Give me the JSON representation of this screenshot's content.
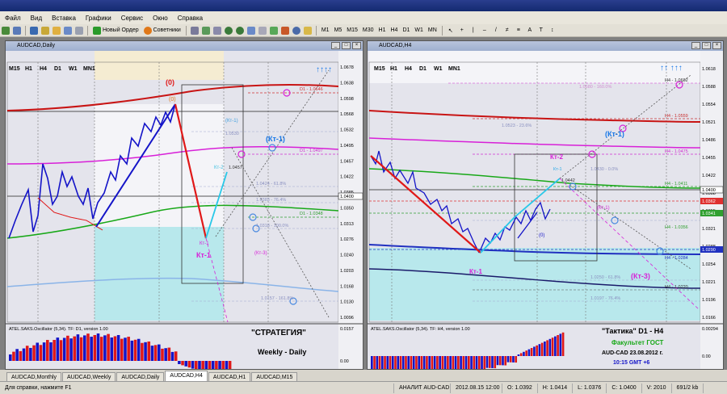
{
  "menu": [
    "Файл",
    "Вид",
    "Вставка",
    "Графики",
    "Сервис",
    "Окно",
    "Справка"
  ],
  "toolbar": {
    "new_order_label": "Новый Ордер",
    "advisors_label": "Советники",
    "timeframes": [
      "M1",
      "M5",
      "M15",
      "M30",
      "H1",
      "H4",
      "D1",
      "W1",
      "MN"
    ]
  },
  "left_chart": {
    "title": "AUDCAD,Daily",
    "tf_buttons": [
      "M15",
      "H1",
      "H4",
      "D1",
      "W1",
      "MN1"
    ],
    "price_axis": [
      "1.0678",
      "1.0638",
      "1.0598",
      "1.0568",
      "1.0532",
      "1.0495",
      "1.0457",
      "1.0422",
      "1.0385",
      "1.0350",
      "1.0313",
      "1.0276",
      "1.0240",
      "1.0203",
      "1.0168",
      "1.0130",
      "1.0096"
    ],
    "price_tag_current": "1.0400",
    "level_labels": {
      "d1_top": "D1 - 1.0646",
      "d1_mid": "D1 - 1.0497",
      "d1_low": "D1 - 1.0348",
      "fib_0": "1.0530",
      "fib_382": "1.0424 - 61.8%",
      "fib_764": "1.0383 - 76.4%",
      "fib_100": "1.0318 - 100.0%",
      "fib_1618": "1.0157 - 161.8%",
      "kt2_price": "1.0457"
    },
    "annotations": {
      "zero_top": "(0)",
      "zero_small": "(0)",
      "kt1_big": "(Кт-1)",
      "kt_small": "(Кт-1)",
      "kt1_label": "Кт-1",
      "kt1_small": "Кт-1",
      "kt2_small": "Кт-2",
      "kt3": "(Кт-3)",
      "strategy": "\"СТРАТЕГИЯ\"",
      "weekly_daily": "Weekly - Daily"
    },
    "oscillator_title": "ATEL.SAKS.Oscillator (5,34). TF: D1, version 1.00",
    "osc_axis": [
      "0.0157",
      "0.00"
    ]
  },
  "right_chart": {
    "title": "AUDCAD,H4",
    "tf_buttons": [
      "M15",
      "H1",
      "H4",
      "D1",
      "W1",
      "MN1"
    ],
    "price_axis": [
      "1.0618",
      "1.0588",
      "1.0554",
      "1.0521",
      "1.0486",
      "1.0455",
      "1.0422",
      "1.0388",
      "1.0355",
      "1.0321",
      "1.0288",
      "1.0254",
      "1.0221",
      "1.0196",
      "1.0166"
    ],
    "price_tag_red": "1.0362",
    "price_tag_cur": "1.0400",
    "price_tag_green": "1.0341",
    "price_tag_blue": "1.0290",
    "level_labels": {
      "h4_top": "H4 - 1.0602",
      "h4_559": "H4 - 1.0559",
      "h4_475": "H4 - 1.0475",
      "h4_411": "H4 - 1.0411",
      "h4_356": "H4 - 1.0356",
      "h4_284": "H4 - 1.0284",
      "h4_220": "H4 - 1.0220",
      "fib_0": "1.0430 - 0.0%",
      "fib_382": "1.0250 - 61.8%",
      "fib_764": "1.0197 - 76.4%",
      "fib_top": "1.0580 - 160.0%",
      "fib_125": "1.0523 - 23.6%",
      "kt2_price": "1.0442"
    },
    "annotations": {
      "kt1_big": "(Кт-1)",
      "kt2": "Кт-2",
      "kt1": "Кт-1",
      "kt3": "(Кт-3)",
      "kt1_small": "(Кт-1)",
      "kt_small": "Кт-1",
      "zero": "(0)",
      "tactic": "\"Тактика\"  D1 - H4",
      "faculty": "Факультет ГОСТ",
      "pair_date": "AUD-CAD 23.08.2012  г.",
      "time": "10:15    GMT +6"
    },
    "oscillator_title": "ATEL.SAKS.Oscillator (5,34). TF: H4, version 1.00",
    "osc_axis": [
      "0.00294",
      "0.00"
    ]
  },
  "tabs": [
    "AUDCAD,Monthly",
    "AUDCAD,Weekly",
    "AUDCAD,Daily",
    "AUDCAD,H4",
    "AUDCAD,H1",
    "AUDCAD,M15"
  ],
  "active_tab": "AUDCAD,H4",
  "status": {
    "help": "Для справки, нажмите F1",
    "profile": "АНАЛИТ AUD-CAD",
    "datetime": "2012.08.15 12:00",
    "open": "O: 1.0392",
    "high": "H: 1.0414",
    "low": "L: 1.0376",
    "close": "C: 1.0400",
    "volume": "V: 2010",
    "traffic": "691/2 kb"
  },
  "colors": {
    "bg": "#0b1b52",
    "plot_bg": "#e4e4ec",
    "up": "#1414c8",
    "down": "#e01818",
    "ma_red": "#c81414",
    "ma_magenta": "#d820d8",
    "ma_green": "#18a818",
    "ma_blue": "#2030c0"
  }
}
